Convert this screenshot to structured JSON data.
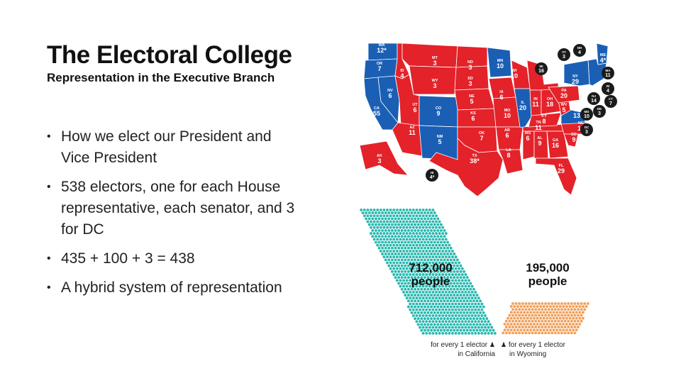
{
  "header": {
    "title": "The Electoral College",
    "subtitle": "Representation in the Executive Branch"
  },
  "bullets": [
    "How we elect our President and Vice President",
    "538 electors, one for each House representative, each senator, and 3 for DC",
    "435 + 100 + 3 = 438",
    "A hybrid system of representation"
  ],
  "map": {
    "colors": {
      "red": "#e3222a",
      "blue": "#1a5fb4",
      "badge": "#1b1b1b"
    },
    "states": [
      {
        "abbr": "WA",
        "votes": "12*",
        "party": "blue"
      },
      {
        "abbr": "OR",
        "votes": "7",
        "party": "blue"
      },
      {
        "abbr": "CA",
        "votes": "55",
        "party": "blue"
      },
      {
        "abbr": "NV",
        "votes": "6",
        "party": "blue"
      },
      {
        "abbr": "ID",
        "votes": "4",
        "party": "red"
      },
      {
        "abbr": "MT",
        "votes": "3",
        "party": "red"
      },
      {
        "abbr": "WY",
        "votes": "3",
        "party": "red"
      },
      {
        "abbr": "UT",
        "votes": "6",
        "party": "red"
      },
      {
        "abbr": "AZ",
        "votes": "11",
        "party": "red"
      },
      {
        "abbr": "CO",
        "votes": "9",
        "party": "blue"
      },
      {
        "abbr": "NM",
        "votes": "5",
        "party": "blue"
      },
      {
        "abbr": "ND",
        "votes": "3",
        "party": "red"
      },
      {
        "abbr": "SD",
        "votes": "3",
        "party": "red"
      },
      {
        "abbr": "NE",
        "votes": "5",
        "party": "red"
      },
      {
        "abbr": "KS",
        "votes": "6",
        "party": "red"
      },
      {
        "abbr": "OK",
        "votes": "7",
        "party": "red"
      },
      {
        "abbr": "TX",
        "votes": "38*",
        "party": "red"
      },
      {
        "abbr": "MN",
        "votes": "10",
        "party": "blue"
      },
      {
        "abbr": "IA",
        "votes": "6",
        "party": "red"
      },
      {
        "abbr": "MO",
        "votes": "10",
        "party": "red"
      },
      {
        "abbr": "AR",
        "votes": "6",
        "party": "red"
      },
      {
        "abbr": "LA",
        "votes": "8",
        "party": "red"
      },
      {
        "abbr": "WI",
        "votes": "10",
        "party": "red"
      },
      {
        "abbr": "IL",
        "votes": "20",
        "party": "blue"
      },
      {
        "abbr": "MS",
        "votes": "6",
        "party": "red"
      },
      {
        "abbr": "IN",
        "votes": "11",
        "party": "red"
      },
      {
        "abbr": "TN",
        "votes": "11",
        "party": "red"
      },
      {
        "abbr": "AL",
        "votes": "9",
        "party": "red"
      },
      {
        "abbr": "OH",
        "votes": "18",
        "party": "red"
      },
      {
        "abbr": "KY",
        "votes": "8",
        "party": "red"
      },
      {
        "abbr": "GA",
        "votes": "16",
        "party": "red"
      },
      {
        "abbr": "FL",
        "votes": "29",
        "party": "red"
      },
      {
        "abbr": "WV",
        "votes": "5",
        "party": "red"
      },
      {
        "abbr": "VA",
        "votes": "13",
        "party": "blue"
      },
      {
        "abbr": "NC",
        "votes": "15",
        "party": "red"
      },
      {
        "abbr": "SC",
        "votes": "9",
        "party": "red"
      },
      {
        "abbr": "PA",
        "votes": "20",
        "party": "red"
      },
      {
        "abbr": "NY",
        "votes": "29",
        "party": "blue"
      },
      {
        "abbr": "ME",
        "votes": "4*",
        "party": "blue"
      },
      {
        "abbr": "AK",
        "votes": "3",
        "party": "red"
      },
      {
        "abbr": "HI",
        "votes": "4*",
        "party": "badge"
      },
      {
        "abbr": "MI",
        "votes": "16",
        "party": "badge"
      },
      {
        "abbr": "VT",
        "votes": "3",
        "party": "badge"
      },
      {
        "abbr": "NH",
        "votes": "4",
        "party": "badge"
      },
      {
        "abbr": "MA",
        "votes": "11",
        "party": "badge"
      },
      {
        "abbr": "RI",
        "votes": "4",
        "party": "badge"
      },
      {
        "abbr": "CT",
        "votes": "7",
        "party": "badge"
      },
      {
        "abbr": "NJ",
        "votes": "14",
        "party": "badge"
      },
      {
        "abbr": "DE",
        "votes": "3",
        "party": "badge"
      },
      {
        "abbr": "MD",
        "votes": "10",
        "party": "badge"
      },
      {
        "abbr": "DC",
        "votes": "3",
        "party": "badge"
      }
    ]
  },
  "comparison": {
    "california": {
      "big": "712,000",
      "big2": "people",
      "caption1": "for every 1 elector",
      "caption2": "in California",
      "color": "#29b8b0"
    },
    "wyoming": {
      "big": "195,000",
      "big2": "people",
      "caption1": "for every 1 elector",
      "caption2": "in Wyoming",
      "color": "#f2a05a"
    }
  }
}
